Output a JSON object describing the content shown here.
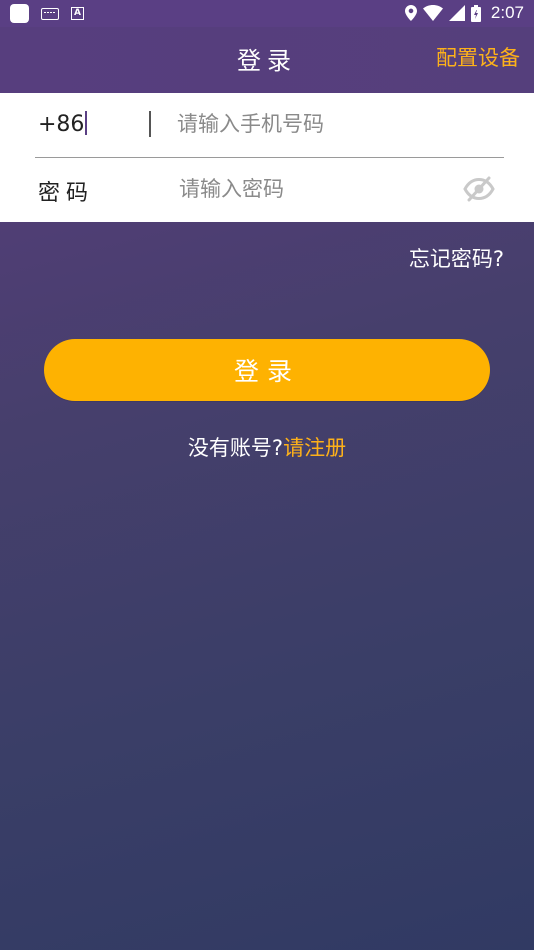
{
  "status_bar": {
    "time": "2:07",
    "icons": [
      "app-icon",
      "keyboard-icon",
      "text-a-icon",
      "location-icon",
      "wifi-icon",
      "signal-icon",
      "battery-icon"
    ]
  },
  "header": {
    "title": "登录",
    "config_label": "配置设备"
  },
  "form": {
    "country_code": "+86",
    "phone_placeholder": "请输入手机号码",
    "password_label": "密码",
    "password_placeholder": "请输入密码",
    "toggle_icon": "eye-off-icon"
  },
  "forgot_label": "忘记密码?",
  "login_button_label": "登录",
  "register": {
    "prompt": "没有账号?",
    "link": "请注册"
  },
  "colors": {
    "accent": "#fdb11a",
    "button": "#feb201",
    "header_bg": "#573e7e",
    "background_top": "#5a3d7e",
    "background_bottom": "#313a63"
  }
}
